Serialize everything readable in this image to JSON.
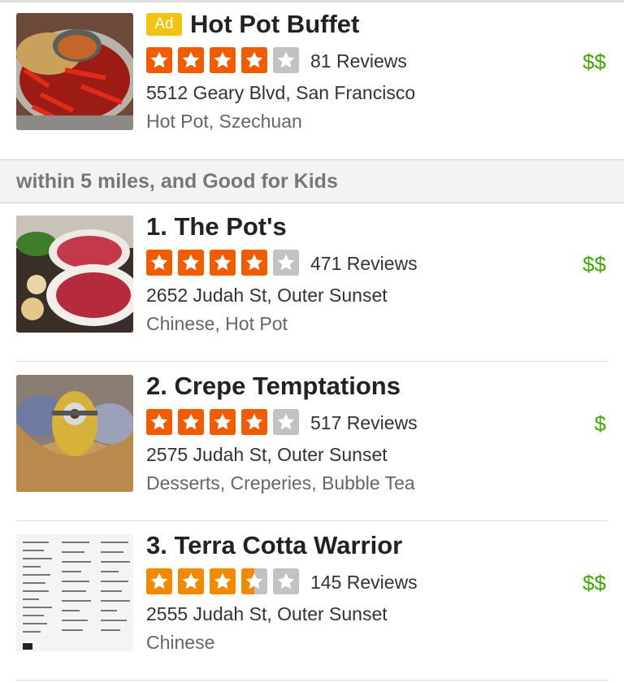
{
  "colors": {
    "star_red": "#f15c00",
    "star_orange": "#f28a00",
    "star_empty": "#c2c2c2",
    "price_green": "#41a700",
    "ad_badge": "#f2c313"
  },
  "ad": {
    "badge": "Ad",
    "name": "Hot Pot Buffet",
    "rating": 4,
    "reviews": "81 Reviews",
    "address": "5512 Geary Blvd, San Francisco",
    "categories": "Hot Pot, Szechuan",
    "price": "$$"
  },
  "filter": {
    "text": "within 5 miles, and Good for Kids"
  },
  "results": [
    {
      "title": "1. The Pot's",
      "rating": 4,
      "reviews": "471 Reviews",
      "address": "2652 Judah St, Outer Sunset",
      "categories": "Chinese, Hot Pot",
      "price": "$$"
    },
    {
      "title": "2. Crepe Temptations",
      "rating": 4,
      "reviews": "517 Reviews",
      "address": "2575 Judah St, Outer Sunset",
      "categories": "Desserts, Creperies, Bubble Tea",
      "price": "$"
    },
    {
      "title": "3. Terra Cotta Warrior",
      "rating": 3.5,
      "reviews": "145 Reviews",
      "address": "2555 Judah St, Outer Sunset",
      "categories": "Chinese",
      "price": "$$"
    }
  ]
}
